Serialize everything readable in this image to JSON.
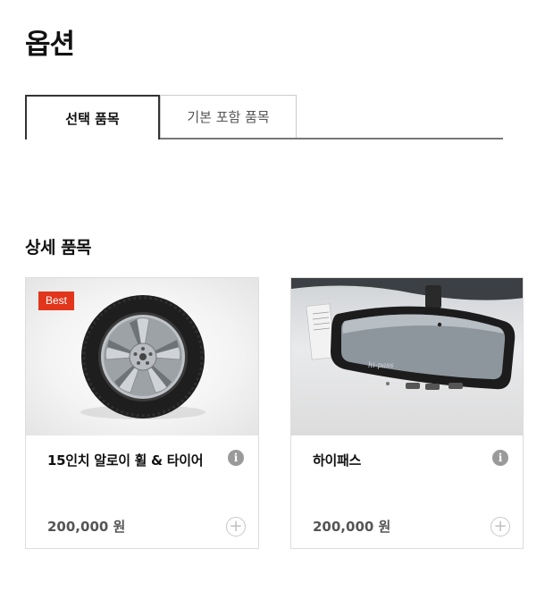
{
  "page": {
    "title": "옵션"
  },
  "tabs": [
    {
      "label": "선택 품목",
      "active": true
    },
    {
      "label": "기본 포함 품목",
      "active": false
    }
  ],
  "section": {
    "title": "상세 품목"
  },
  "items": [
    {
      "name": "15인치 알로이 휠 & 타이어",
      "price": "200,000 원",
      "badge": "Best",
      "image": "alloy-wheel-tire",
      "info_icon": "i",
      "add_icon": "+"
    },
    {
      "name": "하이패스",
      "price": "200,000 원",
      "image": "rearview-mirror-hipass",
      "info_icon": "i",
      "add_icon": "+"
    }
  ],
  "colors": {
    "badge": "#e2361c",
    "text": "#111111",
    "price": "#555555",
    "tab_border": "#333333"
  }
}
